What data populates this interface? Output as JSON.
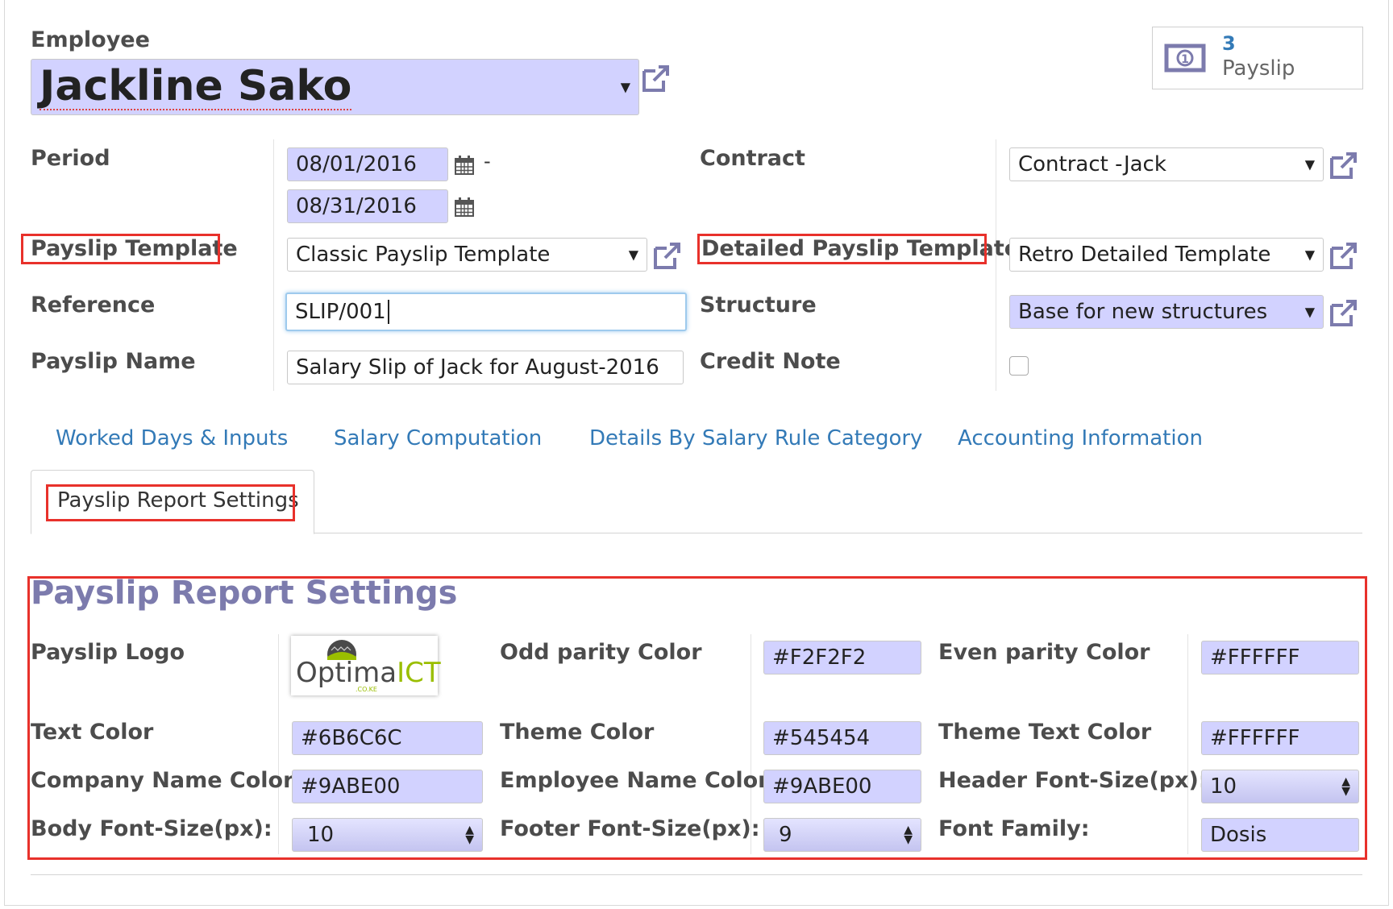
{
  "employee": {
    "label": "Employee",
    "name": "Jackline Sako"
  },
  "payslip_button": {
    "count": "3",
    "label": "Payslip"
  },
  "fields": {
    "period_label": "Period",
    "date_from": "08/01/2016",
    "date_sep": "-",
    "date_to": "08/31/2016",
    "contract_label": "Contract",
    "contract_value": "Contract -Jack",
    "payslip_template_label": "Payslip Template",
    "payslip_template_value": "Classic Payslip Template",
    "detailed_template_label": "Detailed Payslip Template",
    "detailed_template_value": "Retro Detailed Template",
    "reference_label": "Reference",
    "reference_value": "SLIP/001",
    "structure_label": "Structure",
    "structure_value": "Base for new structures",
    "payslip_name_label": "Payslip Name",
    "payslip_name_value": "Salary Slip of Jack for August-2016",
    "credit_note_label": "Credit Note"
  },
  "tabs": [
    {
      "label": "Worked Days & Inputs"
    },
    {
      "label": "Salary Computation"
    },
    {
      "label": "Details By Salary Rule Category"
    },
    {
      "label": "Accounting Information"
    },
    {
      "label": "Payslip Report Settings",
      "active": true
    }
  ],
  "settings": {
    "title": "Payslip Report Settings",
    "logo_label": "Payslip Logo",
    "logo_text_main": "Optima",
    "logo_text_accent": "ICT",
    "logo_text_small": ".CO.KE",
    "odd_label": "Odd parity Color",
    "odd_value": "#F2F2F2",
    "even_label": "Even parity Color",
    "even_value": "#FFFFFF",
    "text_color_label": "Text Color",
    "text_color_value": "#6B6C6C",
    "theme_color_label": "Theme Color",
    "theme_color_value": "#545454",
    "theme_text_label": "Theme Text Color",
    "theme_text_value": "#FFFFFF",
    "company_name_label": "Company Name Color",
    "company_name_value": "#9ABE00",
    "employee_name_label": "Employee Name Color",
    "employee_name_value": "#9ABE00",
    "header_font_label": "Header Font-Size(px):",
    "header_font_value": "10",
    "body_font_label": "Body Font-Size(px):",
    "body_font_value": "10",
    "footer_font_label": "Footer Font-Size(px):",
    "footer_font_value": "9",
    "font_family_label": "Font Family:",
    "font_family_value": "Dosis"
  },
  "colors": {
    "accent": "#7c7bad",
    "link": "#337ab7",
    "required_bg": "#d2d2ff",
    "highlight": "#e8312b"
  }
}
